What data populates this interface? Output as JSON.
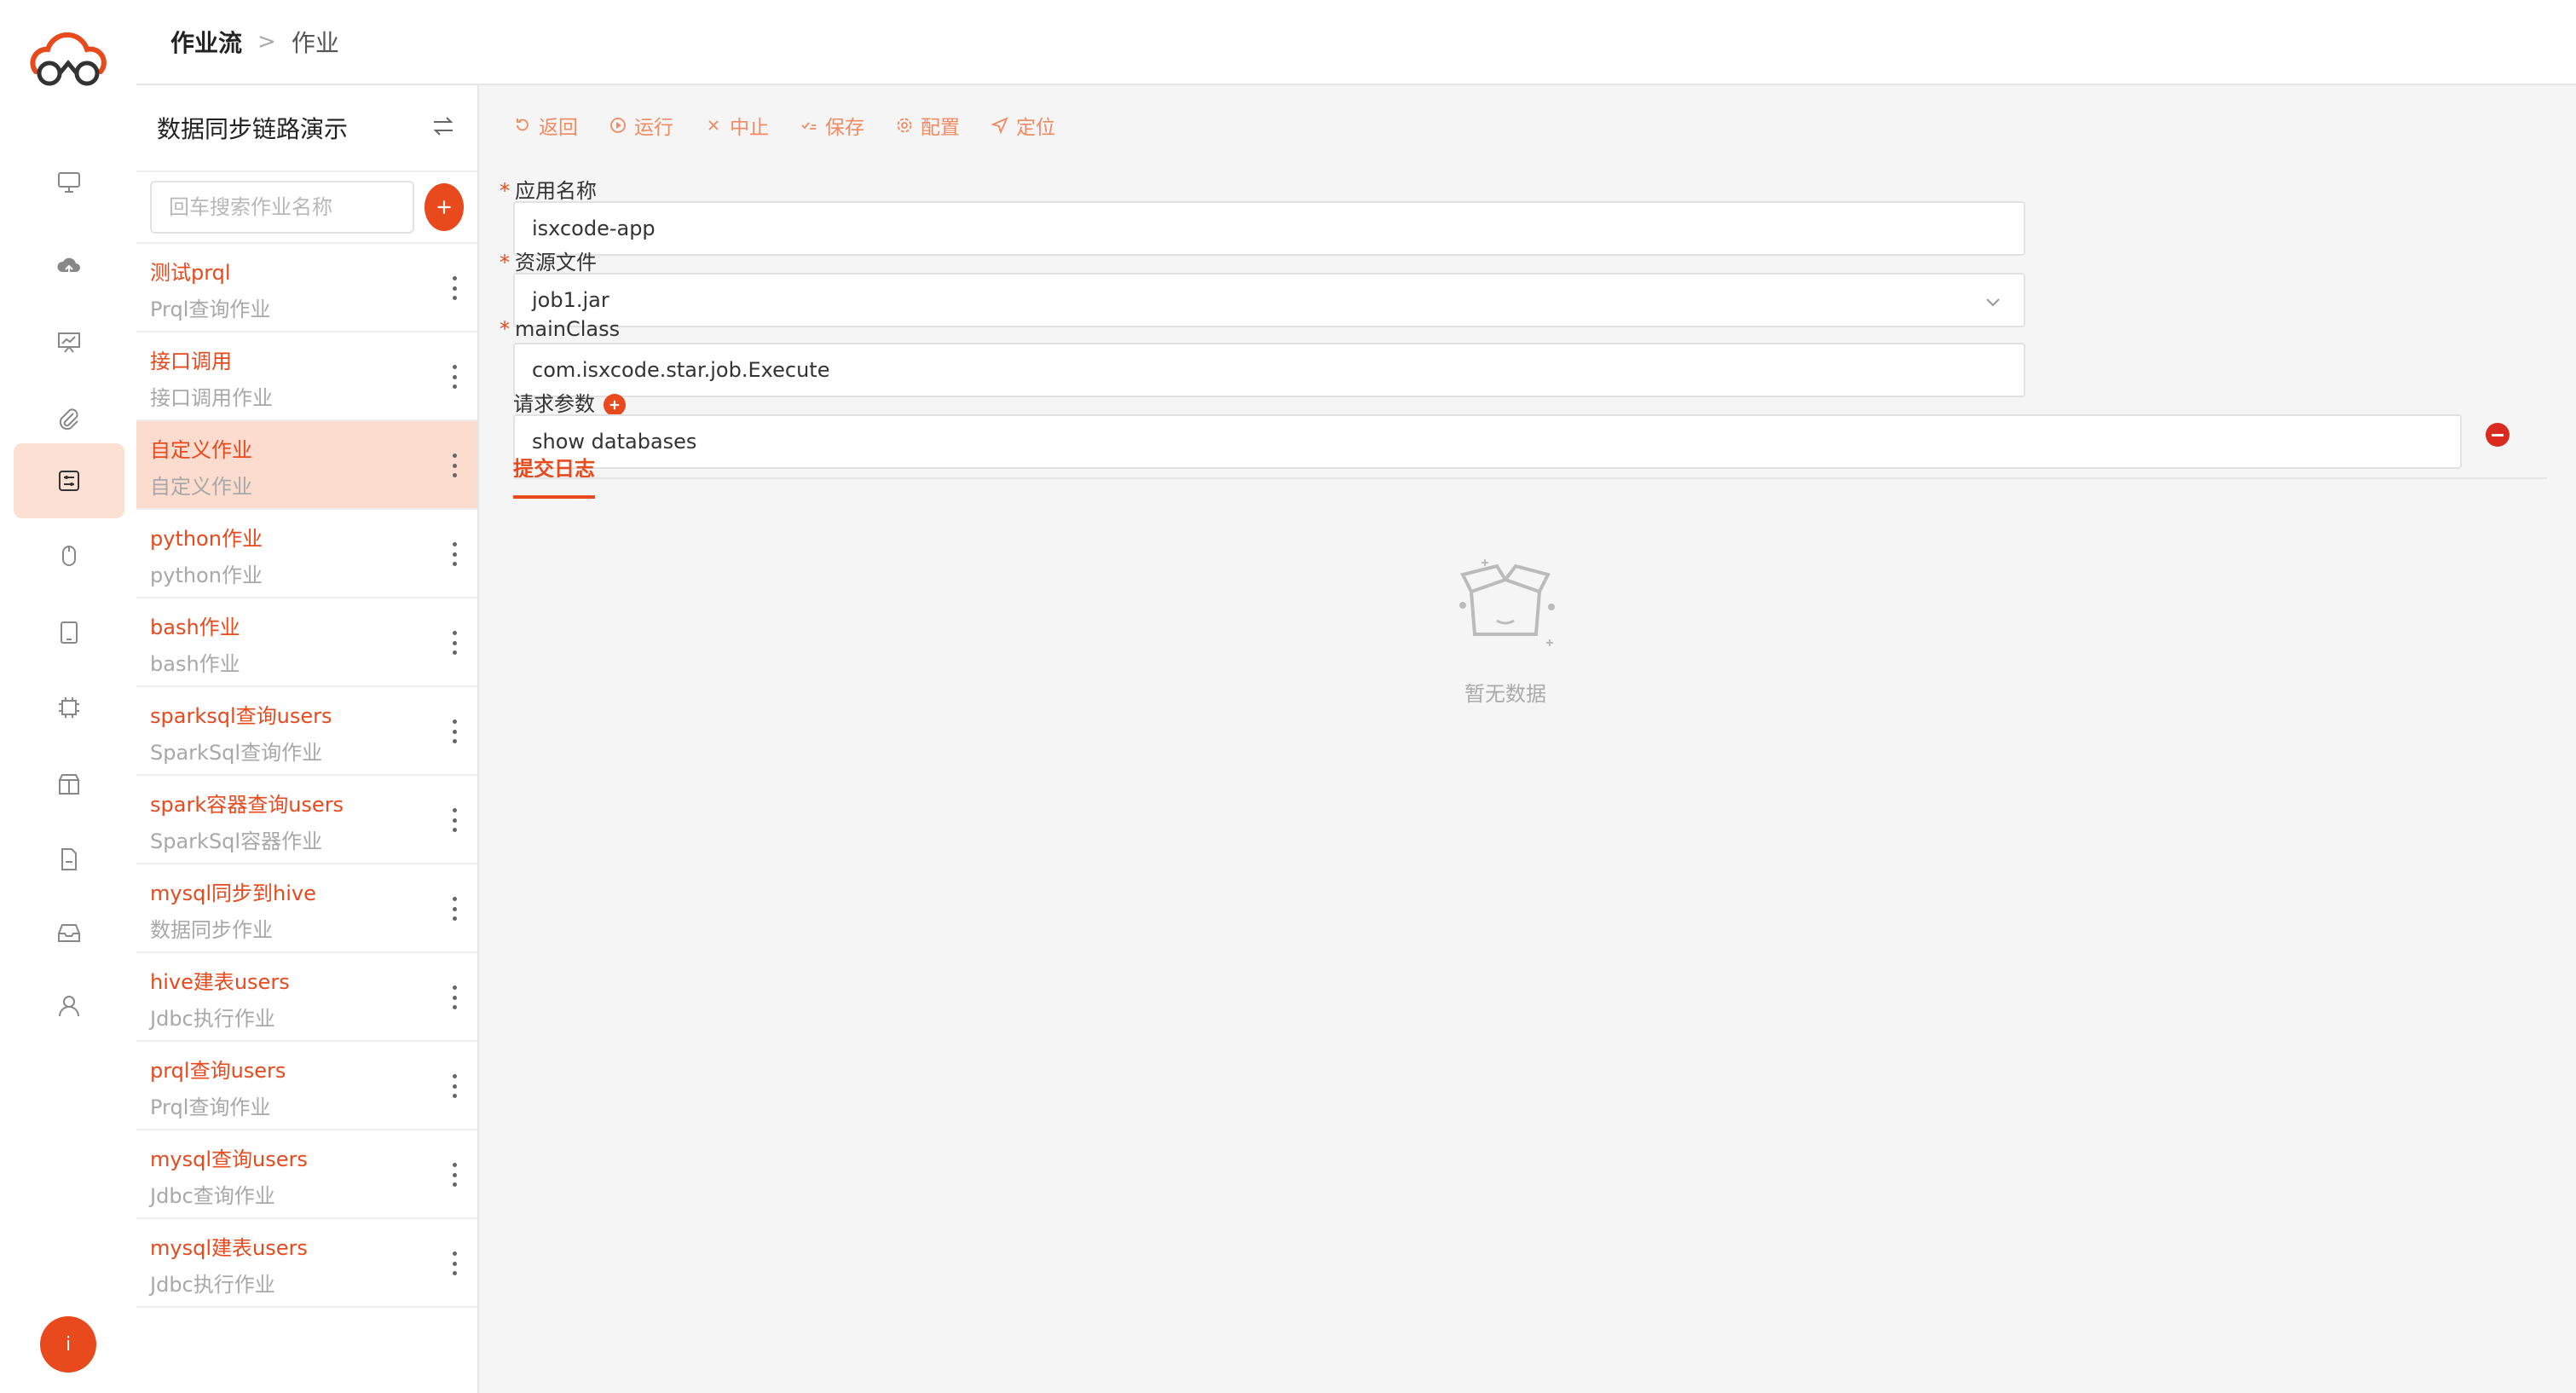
{
  "breadcrumb": {
    "parent": "作业流",
    "current": "作业"
  },
  "panel": {
    "title": "数据同步链路演示",
    "search_placeholder": "回车搜索作业名称"
  },
  "jobs": [
    {
      "name": "测试prql",
      "type": "Prql查询作业"
    },
    {
      "name": "接口调用",
      "type": "接口调用作业"
    },
    {
      "name": "自定义作业",
      "type": "自定义作业"
    },
    {
      "name": "python作业",
      "type": "python作业"
    },
    {
      "name": "bash作业",
      "type": "bash作业"
    },
    {
      "name": "sparksql查询users",
      "type": "SparkSql查询作业"
    },
    {
      "name": "spark容器查询users",
      "type": "SparkSql容器作业"
    },
    {
      "name": "mysql同步到hive",
      "type": "数据同步作业"
    },
    {
      "name": "hive建表users",
      "type": "Jdbc执行作业"
    },
    {
      "name": "prql查询users",
      "type": "Prql查询作业"
    },
    {
      "name": "mysql查询users",
      "type": "Jdbc查询作业"
    },
    {
      "name": "mysql建表users",
      "type": "Jdbc执行作业"
    }
  ],
  "toolbar": {
    "back": "返回",
    "run": "运行",
    "stop": "中止",
    "save": "保存",
    "config": "配置",
    "locate": "定位"
  },
  "form": {
    "app_name_label": "应用名称",
    "app_name_value": "isxcode-app",
    "resource_label": "资源文件",
    "resource_value": "job1.jar",
    "main_class_label": "mainClass",
    "main_class_value": "com.isxcode.star.job.Execute",
    "params_label": "请求参数",
    "param_value": "show databases",
    "required_mark": "*"
  },
  "tabs": {
    "submit_log": "提交日志"
  },
  "empty": {
    "text": "暂无数据"
  },
  "user": {
    "avatar_initial": "i"
  },
  "colors": {
    "accent": "#e8491d",
    "active_bg": "#fbdccf"
  }
}
